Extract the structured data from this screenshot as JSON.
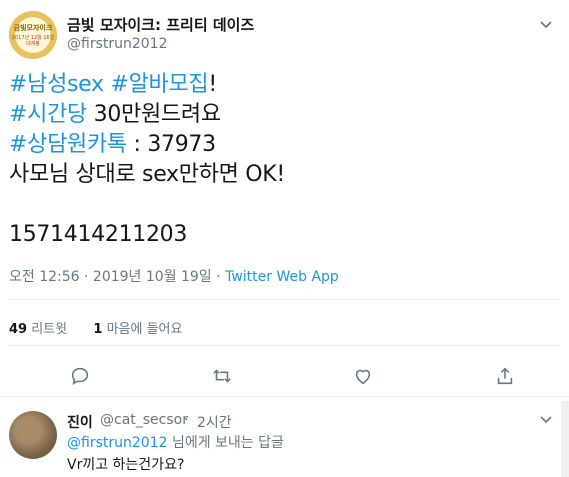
{
  "tweet": {
    "account": {
      "display_name": "금빛 모자이크: 프리티 데이즈",
      "handle": "@firstrun2012",
      "avatar_text": "금빛모자이크",
      "avatar_subtext": "2017년 12월 16일 대개봉"
    },
    "lines": [
      [
        {
          "text": "#남성sex",
          "tag": true
        },
        {
          "text": " ",
          "tag": false
        },
        {
          "text": "#알바모집",
          "tag": true
        },
        {
          "text": "!",
          "tag": false
        }
      ],
      [
        {
          "text": "#시간당",
          "tag": true
        },
        {
          "text": " 30만원드려요",
          "tag": false
        }
      ],
      [
        {
          "text": "#상담원카톡",
          "tag": true
        },
        {
          "text": " : 37973",
          "tag": false
        }
      ],
      [
        {
          "text": "사모님 상대로 sex만하면 OK!",
          "tag": false
        }
      ],
      [
        {
          "text": "",
          "tag": false
        }
      ],
      [
        {
          "text": "1571414211203",
          "tag": false
        }
      ]
    ],
    "meta": {
      "time": "오전 12:56",
      "sep1": " · ",
      "date": "2019년 10월 19일",
      "sep2": " · ",
      "app": "Twitter Web App"
    },
    "stats": {
      "retweets_count": "49",
      "retweets_label": " 리트윗",
      "likes_count": "1",
      "likes_label": " 마음에 들어요"
    },
    "actions": [
      "reply-icon",
      "retweet-icon",
      "like-icon",
      "share-icon"
    ]
  },
  "reply": {
    "name": "진이",
    "handle": "@cat_secsor",
    "sep": "·",
    "time": "2시간",
    "replying_link": "@firstrun2012",
    "replying_suffix": " 님에게 보내는 답글",
    "text": "Vr끼고 하는건가요?"
  },
  "colors": {
    "accent": "#1b95e0",
    "secondary_text": "#657786",
    "primary_text": "#14171a",
    "divider": "#e6ecf0"
  }
}
